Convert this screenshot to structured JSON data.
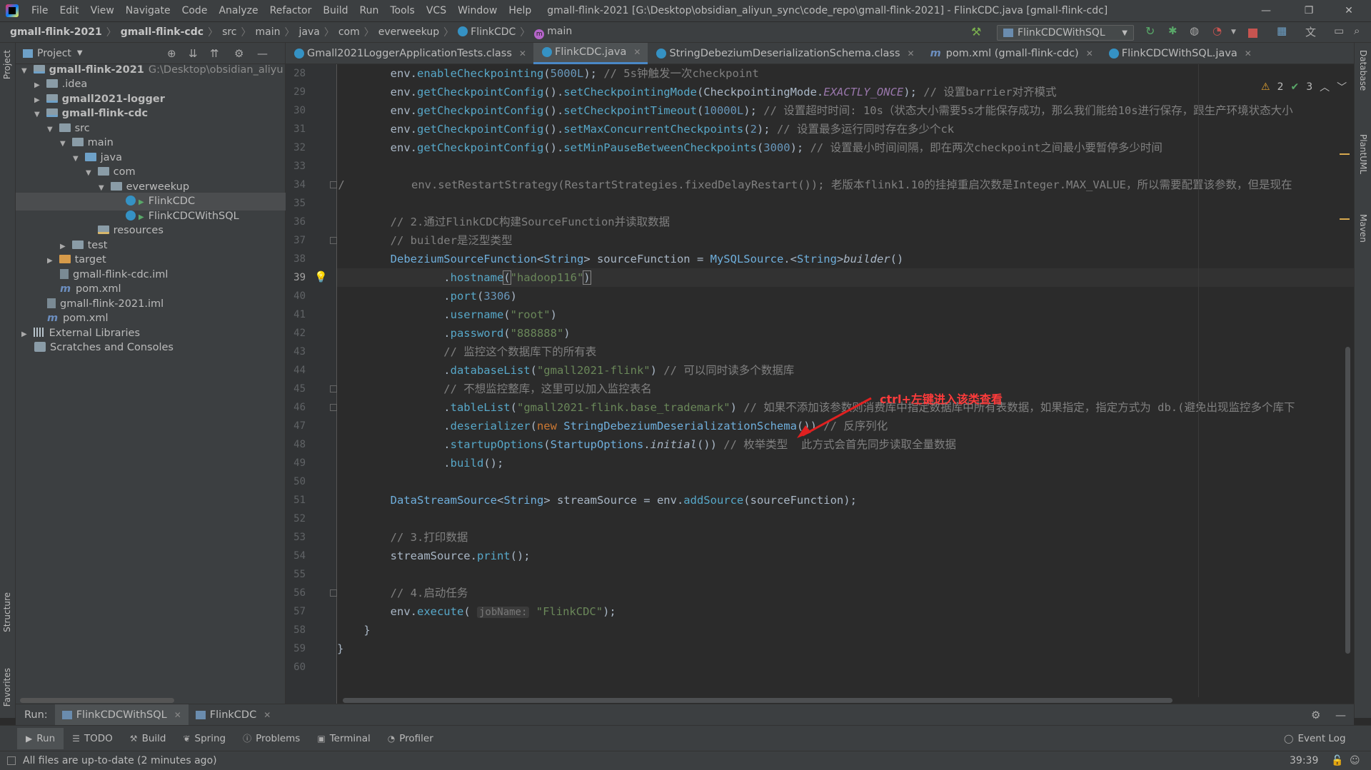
{
  "titlebar": {
    "menu": [
      "File",
      "Edit",
      "View",
      "Navigate",
      "Code",
      "Analyze",
      "Refactor",
      "Build",
      "Run",
      "Tools",
      "VCS",
      "Window",
      "Help"
    ],
    "window_title": "gmall-flink-2021 [G:\\Desktop\\obsidian_aliyun_sync\\code_repo\\gmall-flink-2021] - FlinkCDC.java [gmall-flink-cdc]"
  },
  "navbar": {
    "crumbs": [
      "gmall-flink-2021",
      "gmall-flink-cdc",
      "src",
      "main",
      "java",
      "com",
      "everweekup",
      "FlinkCDC",
      "main"
    ],
    "run_config": "FlinkCDCWithSQL"
  },
  "side_tabs": {
    "left_top": "Project",
    "left_structure": "Structure",
    "left_favorites": "Favorites",
    "right_db": "Database",
    "right_plant": "PlantUML",
    "right_maven": "Maven"
  },
  "project": {
    "header": "Project",
    "tree": [
      {
        "label": "gmall-flink-2021",
        "path": "G:\\Desktop\\obsidian_aliyu"
      },
      {
        "label": ".idea"
      },
      {
        "label": "gmall2021-logger"
      },
      {
        "label": "gmall-flink-cdc"
      },
      {
        "label": "src"
      },
      {
        "label": "main"
      },
      {
        "label": "java"
      },
      {
        "label": "com"
      },
      {
        "label": "everweekup"
      },
      {
        "label": "FlinkCDC"
      },
      {
        "label": "FlinkCDCWithSQL"
      },
      {
        "label": "resources"
      },
      {
        "label": "test"
      },
      {
        "label": "target"
      },
      {
        "label": "gmall-flink-cdc.iml"
      },
      {
        "label": "pom.xml"
      },
      {
        "label": "gmall-flink-2021.iml"
      },
      {
        "label": "pom.xml"
      },
      {
        "label": "External Libraries"
      },
      {
        "label": "Scratches and Consoles"
      }
    ]
  },
  "editor_tabs": [
    {
      "label": "Gmall2021LoggerApplicationTests.class",
      "active": false
    },
    {
      "label": "FlinkCDC.java",
      "active": true
    },
    {
      "label": "StringDebeziumDeserializationSchema.class",
      "active": false
    },
    {
      "label": "pom.xml (gmall-flink-cdc)",
      "active": false
    },
    {
      "label": "FlinkCDCWithSQL.java",
      "active": false
    }
  ],
  "inspections": {
    "warnings": "2",
    "ok": "3"
  },
  "line_numbers": [
    "28",
    "29",
    "30",
    "31",
    "32",
    "33",
    "34",
    "35",
    "36",
    "37",
    "38",
    "39",
    "40",
    "41",
    "42",
    "43",
    "44",
    "45",
    "46",
    "47",
    "48",
    "49",
    "50",
    "51",
    "52",
    "53",
    "54",
    "55",
    "56",
    "57",
    "58",
    "59",
    "60"
  ],
  "current_line": "39",
  "code": {
    "l28": {
      "a": "        env.",
      "b": "enableCheckpointing",
      "c": "(",
      "d": "5000L",
      "e": "); ",
      "f": "// 5s钟触发一次checkpoint"
    },
    "l29": {
      "a": "        env.",
      "b": "getCheckpointConfig",
      "c": "().",
      "d": "setCheckpointingMode",
      "e": "(CheckpointingMode.",
      "f": "EXACTLY_ONCE",
      "g": "); ",
      "h": "// 设置barrier对齐模式"
    },
    "l30": {
      "a": "        env.",
      "b": "getCheckpointConfig",
      "c": "().",
      "d": "setCheckpointTimeout",
      "e": "(",
      "f": "10000L",
      "g": "); ",
      "h": "// 设置超时时间: 10s（状态大小需要5s才能保存成功，那么我们能给10s进行保存，跟生产环境状态大小"
    },
    "l31": {
      "a": "        env.",
      "b": "getCheckpointConfig",
      "c": "().",
      "d": "setMaxConcurrentCheckpoints",
      "e": "(",
      "f": "2",
      "g": "); ",
      "h": "// 设置最多运行同时存在多少个ck"
    },
    "l32": {
      "a": "        env.",
      "b": "getCheckpointConfig",
      "c": "().",
      "d": "setMinPauseBetweenCheckpoints",
      "e": "(",
      "f": "3000",
      "g": "); ",
      "h": "// 设置最小时间间隔，即在两次checkpoint之间最小要暂停多少时间"
    },
    "l34": {
      "a": "//          env.setRestartStrategy(RestartStrategies.fixedDelayRestart()); 老版本flink1.10的挂掉重启次数是Integer.MAX_VALUE，所以需要配置该参数，但是现在"
    },
    "l36": {
      "a": "        // 2.通过FlinkCDC构建SourceFunction并读取数据"
    },
    "l37": {
      "a": "        // builder是泛型类型"
    },
    "l38": {
      "a": "        ",
      "b": "DebeziumSourceFunction",
      "c": "<",
      "d": "String",
      "e": "> sourceFunction = ",
      "f": "MySQLSource",
      "g": ".<",
      "h": "String",
      "i": ">",
      "j": "builder",
      "k": "()"
    },
    "l39": {
      "a": "                .",
      "b": "hostname",
      "c": "(",
      "d": "\"hadoop116\"",
      "e": ")"
    },
    "l40": {
      "a": "                .",
      "b": "port",
      "c": "(",
      "d": "3306",
      "e": ")"
    },
    "l41": {
      "a": "                .",
      "b": "username",
      "c": "(",
      "d": "\"root\"",
      "e": ")"
    },
    "l42": {
      "a": "                .",
      "b": "password",
      "c": "(",
      "d": "\"888888\"",
      "e": ")"
    },
    "l43": {
      "a": "                // 监控这个数据库下的所有表"
    },
    "l44": {
      "a": "                .",
      "b": "databaseList",
      "c": "(",
      "d": "\"gmall2021-flink\"",
      "e": ") ",
      "f": "// 可以同时读多个数据库"
    },
    "l45": {
      "a": "                // 不想监控整库，这里可以加入监控表名"
    },
    "l46": {
      "a": "                .",
      "b": "tableList",
      "c": "(",
      "d": "\"gmall2021-flink.base_trademark\"",
      "e": ") ",
      "f": "// 如果不添加该参数则消费库中指定数据库中所有表数据，如果指定，指定方式为 db.(避免出现监控多个库下"
    },
    "l47": {
      "a": "                .",
      "b": "deserializer",
      "c": "(",
      "d": "new ",
      "e": "StringDebeziumDeserializationSchema",
      "f": "()) ",
      "g": "// 反序列化"
    },
    "l48": {
      "a": "                .",
      "b": "startupOptions",
      "c": "(",
      "d": "StartupOptions",
      "e": ".",
      "f": "initial",
      "g": "()) ",
      "h": "// 枚举类型  此方式会首先同步读取全量数据"
    },
    "l49": {
      "a": "                .",
      "b": "build",
      "c": "();"
    },
    "l51": {
      "a": "        ",
      "b": "DataStreamSource",
      "c": "<",
      "d": "String",
      "e": "> streamSource = env.",
      "f": "addSource",
      "g": "(sourceFunction);"
    },
    "l53": {
      "a": "        // 3.打印数据"
    },
    "l54": {
      "a": "        streamSource.",
      "b": "print",
      "c": "();"
    },
    "l56": {
      "a": "        // 4.启动任务"
    },
    "l57": {
      "a": "        env.",
      "b": "execute",
      "c": "( ",
      "d": "jobName:",
      "e": " ",
      "f": "\"FlinkCDC\"",
      "g": ");"
    },
    "l58": {
      "a": "    }"
    },
    "l59": {
      "a": "}"
    }
  },
  "annotation": "ctrl+左键进入该类查看",
  "run_bar": {
    "label": "Run:",
    "tabs": [
      "FlinkCDCWithSQL",
      "FlinkCDC"
    ]
  },
  "bottom_tabs": [
    "Run",
    "TODO",
    "Build",
    "Spring",
    "Problems",
    "Terminal",
    "Profiler"
  ],
  "event_log": "Event Log",
  "status": {
    "message": "All files are up-to-date (2 minutes ago)",
    "position": "39:39"
  }
}
